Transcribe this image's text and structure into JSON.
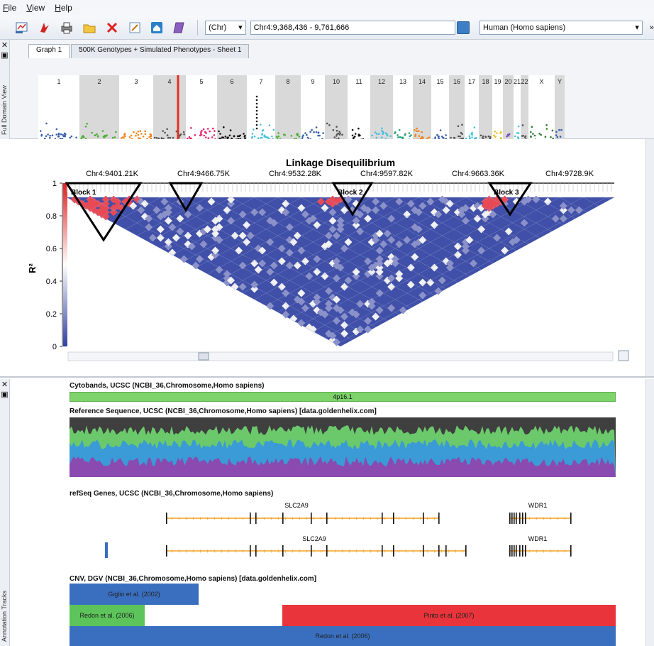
{
  "menu": [
    "File",
    "View",
    "Help"
  ],
  "toolbar": {
    "chr_label": "(Chr)",
    "location": "Chr4:9,368,436 - 9,761,666",
    "species": "Human (Homo sapiens)",
    "more": "»",
    "icons": [
      "new-plot-icon",
      "pdf-icon",
      "print-icon",
      "open-folder-icon",
      "close-red-x-icon",
      "edit-icon",
      "home-icon",
      "notebook-icon"
    ]
  },
  "full_domain": {
    "rail_label": "Full Domain View",
    "tabs": [
      "Graph 1",
      "500K Genotypes + Simulated Phenotypes - Sheet 1"
    ],
    "chromosomes": [
      "1",
      "2",
      "3",
      "4",
      "5",
      "6",
      "7",
      "8",
      "9",
      "10",
      "11",
      "12",
      "13",
      "14",
      "15",
      "16",
      "17",
      "18",
      "19",
      "20",
      "21",
      "22",
      "X",
      "Y"
    ],
    "chrom_colors": [
      "#3a5fb0",
      "#4caf35",
      "#f0821e",
      "#555555",
      "#e8256a",
      "#111111",
      "#45c0e0",
      "#4caf35",
      "#3a5fb0",
      "#555555",
      "#111111",
      "#45c0e0",
      "#2ca37a",
      "#f0821e",
      "#3a5fb0",
      "#555555",
      "#45c0e0",
      "#555555",
      "#f0c020",
      "#7a4fb5",
      "#45c0e0",
      "#555555",
      "#2e7d32",
      "#3a5fb0"
    ],
    "chrom_widths": [
      58,
      56,
      48,
      46,
      44,
      42,
      40,
      36,
      34,
      32,
      32,
      32,
      28,
      26,
      25,
      22,
      20,
      19,
      15,
      15,
      10,
      11,
      37,
      14
    ]
  },
  "ld": {
    "title": "Linkage Disequilibrium",
    "ylabel": "R²",
    "yticks": [
      "0",
      "0.2",
      "0.4",
      "0.6",
      "0.8",
      "1"
    ],
    "positions": [
      "Chr4:9401.21K",
      "Chr4:9466.75K",
      "Chr4:9532.28K",
      "Chr4:9597.82K",
      "Chr4:9663.36K",
      "Chr4:9728.9K"
    ],
    "blocks": [
      "Block 1",
      "Block 2",
      "Block 3"
    ]
  },
  "annotation": {
    "rail_label": "Annotation Tracks",
    "cytobands_title": "Cytobands, UCSC (NCBI_36,Chromosome,Homo sapiens)",
    "cytoband_label": "4p16.1",
    "refseq_title": "Reference Sequence, UCSC (NCBI_36,Chromosome,Homo sapiens) [data.goldenhelix.com]",
    "genes_title": "refSeq Genes, UCSC (NCBI_36,Chromosome,Homo sapiens)",
    "gene_a": "SLC2A9",
    "gene_b": "SLC2A9",
    "gene_c": "WDR1",
    "gene_d": "WDR1",
    "cnv_title": "CNV, DGV (NCBI_36,Chromosome,Homo sapiens) [data.goldenhelix.com]",
    "cnv_1": "Giglio et al. (2002)",
    "cnv_2": "Redon et al. (2006)",
    "cnv_3": "Pinto et al. (2007)",
    "cnv_4": "Redon et al. (2006)"
  },
  "colors": {
    "ld_high": "#e8404a",
    "ld_low": "#3f4fa8",
    "block_outline": "#000000",
    "cnv_blue": "#3a6fbf",
    "cnv_green": "#5cc45a",
    "cnv_red": "#e8343a"
  }
}
